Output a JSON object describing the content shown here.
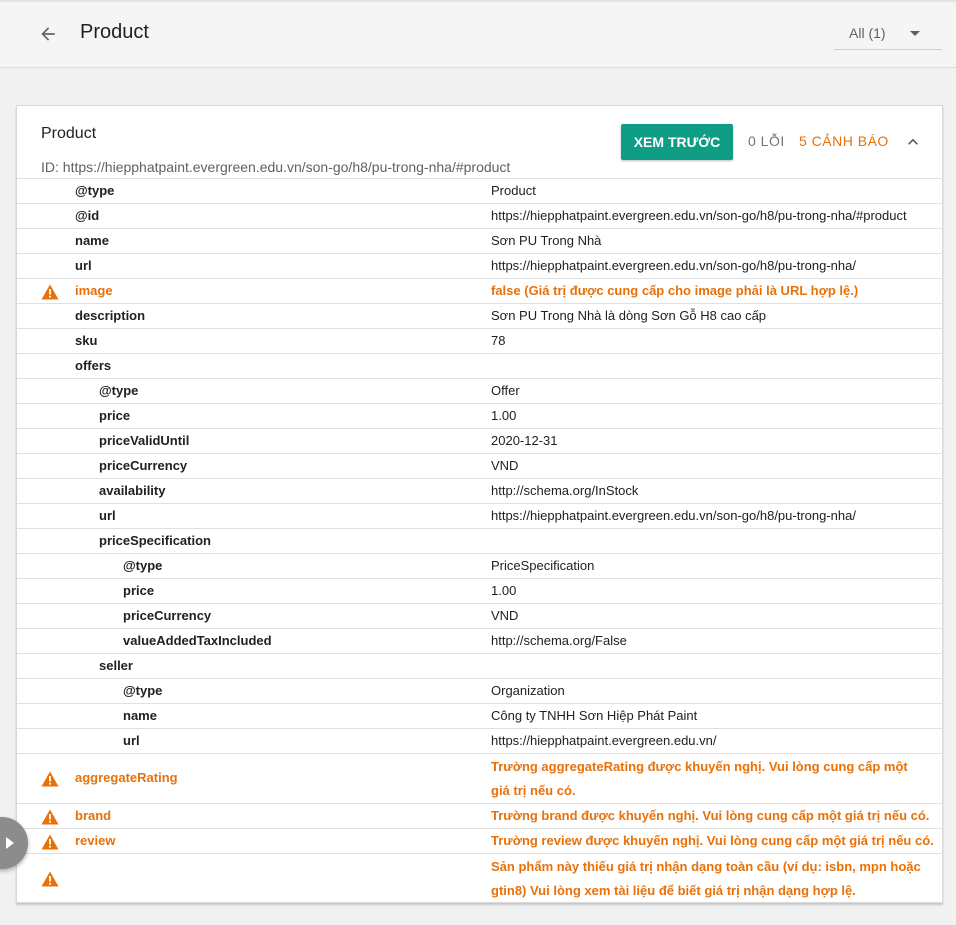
{
  "header": {
    "title": "Product",
    "filter_label": "All (1)"
  },
  "card": {
    "title": "Product",
    "id_text": "ID: https://hiepphatpaint.evergreen.edu.vn/son-go/h8/pu-trong-nha/#product",
    "preview_label": "XEM TRƯỚC",
    "errors_label": "0 LỖI",
    "warnings_label": "5 CẢNH BÁO"
  },
  "colors": {
    "accent": "#0f9d85",
    "warning": "#e8710a"
  },
  "icons": {
    "back": "arrow-left-icon",
    "collapse": "chevron-up-icon",
    "warning": "warning-triangle-icon",
    "dropdown": "caret-down-icon"
  },
  "rows": [
    {
      "key": "@type",
      "value": "Product",
      "depth": 0
    },
    {
      "key": "@id",
      "value": "https://hiepphatpaint.evergreen.edu.vn/son-go/h8/pu-trong-nha/#product",
      "depth": 0
    },
    {
      "key": "name",
      "value": "Sơn PU Trong Nhà",
      "depth": 0
    },
    {
      "key": "url",
      "value": "https://hiepphatpaint.evergreen.edu.vn/son-go/h8/pu-trong-nha/",
      "depth": 0
    },
    {
      "key": "image",
      "value": "false (Giá trị được cung cấp cho image phải là URL hợp lệ.)",
      "depth": 0,
      "warning": true
    },
    {
      "key": "description",
      "value": "Sơn PU Trong Nhà là dòng Sơn Gỗ H8 cao cấp",
      "depth": 0
    },
    {
      "key": "sku",
      "value": "78",
      "depth": 0
    },
    {
      "key": "offers",
      "value": "",
      "depth": 0
    },
    {
      "key": "@type",
      "value": "Offer",
      "depth": 1
    },
    {
      "key": "price",
      "value": "1.00",
      "depth": 1
    },
    {
      "key": "priceValidUntil",
      "value": "2020-12-31",
      "depth": 1
    },
    {
      "key": "priceCurrency",
      "value": "VND",
      "depth": 1
    },
    {
      "key": "availability",
      "value": "http://schema.org/InStock",
      "depth": 1
    },
    {
      "key": "url",
      "value": "https://hiepphatpaint.evergreen.edu.vn/son-go/h8/pu-trong-nha/",
      "depth": 1
    },
    {
      "key": "priceSpecification",
      "value": "",
      "depth": 1
    },
    {
      "key": "@type",
      "value": "PriceSpecification",
      "depth": 2
    },
    {
      "key": "price",
      "value": "1.00",
      "depth": 2
    },
    {
      "key": "priceCurrency",
      "value": "VND",
      "depth": 2
    },
    {
      "key": "valueAddedTaxIncluded",
      "value": "http://schema.org/False",
      "depth": 2
    },
    {
      "key": "seller",
      "value": "",
      "depth": 1
    },
    {
      "key": "@type",
      "value": "Organization",
      "depth": 2
    },
    {
      "key": "name",
      "value": "Công ty TNHH Sơn Hiệp Phát Paint",
      "depth": 2
    },
    {
      "key": "url",
      "value": "https://hiepphatpaint.evergreen.edu.vn/",
      "depth": 2
    },
    {
      "key": "aggregateRating",
      "value": "Trường aggregateRating được khuyến nghị. Vui lòng cung cấp một giá trị nếu có.",
      "depth": 0,
      "warning": true,
      "tall": true
    },
    {
      "key": "brand",
      "value": "Trường brand được khuyến nghị. Vui lòng cung cấp một giá trị nếu có.",
      "depth": 0,
      "warning": true
    },
    {
      "key": "review",
      "value": "Trường review được khuyến nghị. Vui lòng cung cấp một giá trị nếu có.",
      "depth": 0,
      "warning": true
    },
    {
      "key": "",
      "value": "Sản phẩm này thiếu giá trị nhận dạng toàn cầu (ví dụ: isbn, mpn hoặc gtin8) Vui lòng xem tài liệu để biết giá trị nhận dạng hợp lệ.",
      "depth": 0,
      "warning": true,
      "tall": true
    }
  ]
}
